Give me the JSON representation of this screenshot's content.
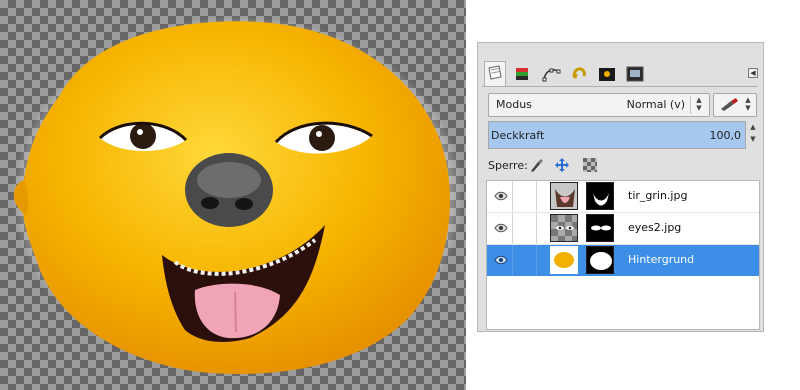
{
  "canvas": {
    "image_subject": "orange-face"
  },
  "dock": {
    "tabs": [
      "layers-tab-icon",
      "channels-tab-icon",
      "paths-tab-icon",
      "undo-history-tab-icon",
      "images-tab-icon",
      "document-tab-icon"
    ],
    "mode": {
      "label": "Modus",
      "value": "Normal (v)"
    },
    "opacity": {
      "label": "Deckkraft",
      "value": "100,0",
      "percent": 100
    },
    "lock": {
      "label": "Sperre:"
    },
    "layers": [
      {
        "name": "tir_grin.jpg",
        "visible": true,
        "selected": false
      },
      {
        "name": "eyes2.jpg",
        "visible": true,
        "selected": false
      },
      {
        "name": "Hintergrund",
        "visible": true,
        "selected": true
      }
    ]
  },
  "colors": {
    "selection": "#3d8ee6",
    "opacity_fill": "#a6c8ef",
    "orange": "#f4b000"
  }
}
